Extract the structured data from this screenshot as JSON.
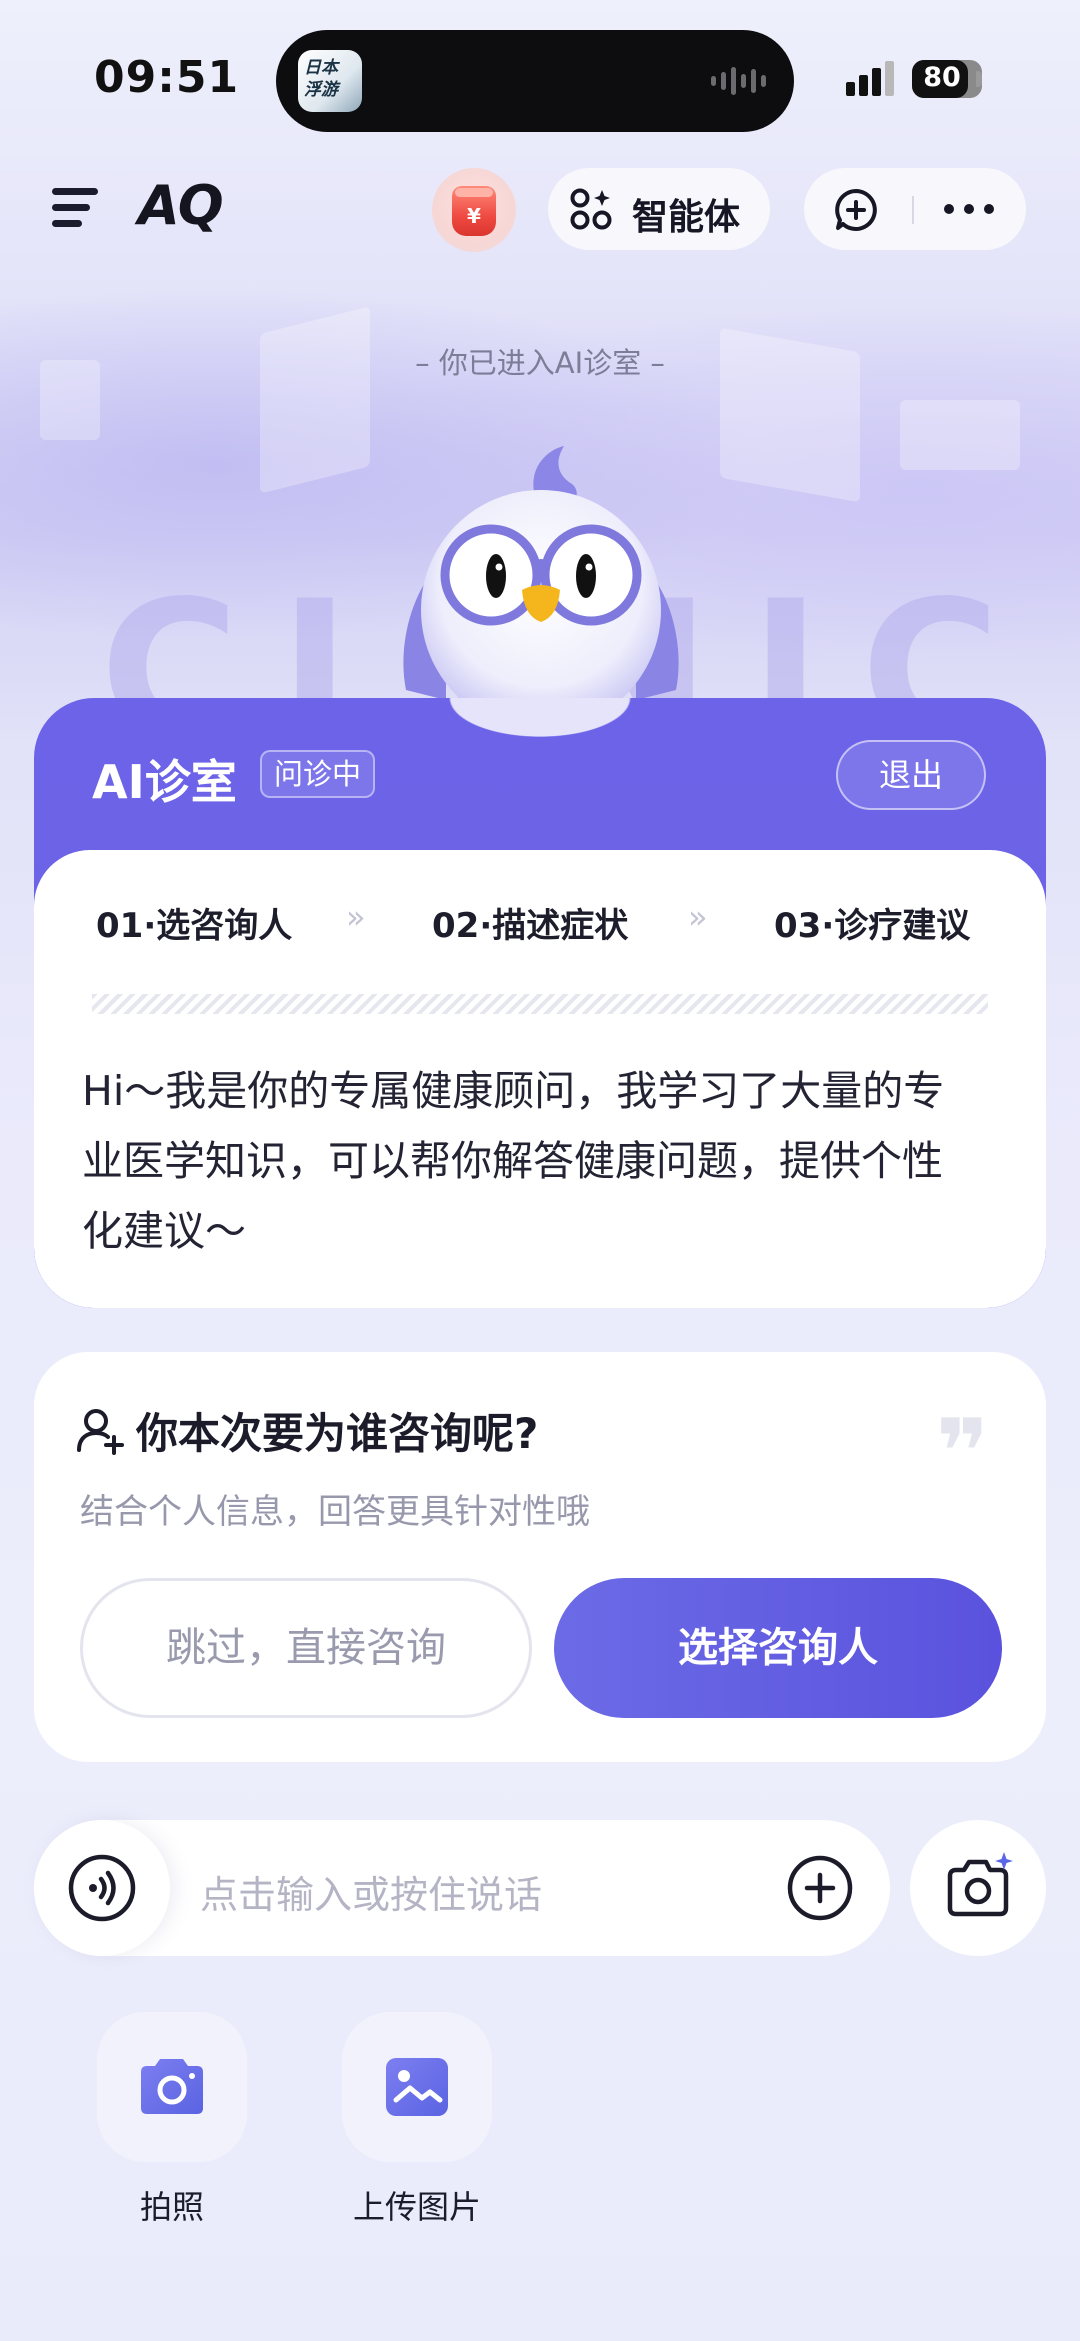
{
  "status_bar": {
    "time": "09:51",
    "island_app_text_line1": "日本",
    "island_app_text_line2": "浮游",
    "battery_level": 80,
    "battery_text": "80"
  },
  "nav": {
    "logo": "AQ",
    "wallet_symbol": "¥",
    "agent_label": "智能体"
  },
  "hero": {
    "entered_note": "–   你已进入AI诊室   –",
    "watermark": "CLINIC"
  },
  "clinic": {
    "title": "AI诊室",
    "status_badge": "问诊中",
    "exit_label": "退出",
    "steps": [
      {
        "label": "01·选咨询人"
      },
      {
        "label": "02·描述症状"
      },
      {
        "label": "03·诊疗建议"
      }
    ],
    "step_separator": "»",
    "intro_text": "Hi～我是你的专属健康顾问，我学习了大量的专业医学知识，可以帮你解答健康问题，提供个性化建议～"
  },
  "consult": {
    "question": "你本次要为谁咨询呢?",
    "subtitle": "结合个人信息，回答更具针对性哦",
    "skip_label": "跳过，直接咨询",
    "choose_label": "选择咨询人",
    "quote_glyph": "❞"
  },
  "input": {
    "placeholder": "点击输入或按住说话"
  },
  "actions": [
    {
      "label": "拍照",
      "icon": "camera-icon"
    },
    {
      "label": "上传图片",
      "icon": "image-icon"
    }
  ],
  "colors": {
    "accent": "#6c63e8",
    "accent_dark": "#5a52de",
    "action_icon": "#6a6fe6"
  }
}
